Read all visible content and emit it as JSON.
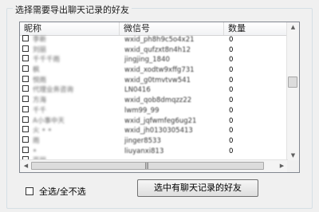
{
  "group": {
    "title": "选择需要导出聊天记录的好友"
  },
  "table": {
    "columns": [
      "昵称",
      "微信号",
      "数量"
    ],
    "rows": [
      {
        "nick": "李新",
        "wechat_id": "wxid_ph8h9c5o4x21",
        "count": "0"
      },
      {
        "nick": "刘丽",
        "wechat_id": "wxid_qufzxt8n4h12",
        "count": "0"
      },
      {
        "nick": "千千千雨",
        "wechat_id": "jingjing_1840",
        "count": "0"
      },
      {
        "nick": "枫",
        "wechat_id": "wxid_xodtw9xffg731",
        "count": "0"
      },
      {
        "nick": "悦雨",
        "wechat_id": "wxid_g0tmvtvw541",
        "count": "0"
      },
      {
        "nick": "代理业务咨询",
        "wechat_id": "LN0416",
        "count": "0"
      },
      {
        "nick": "方海",
        "wechat_id": "wxid_qob8dmqzz22",
        "count": "0"
      },
      {
        "nick": "千千",
        "wechat_id": "lwm99_99",
        "count": "0"
      },
      {
        "nick": "A小事中天",
        "wechat_id": "wxid_jqfwmfeg6ug21",
        "count": "0"
      },
      {
        "nick": "火 • •",
        "wechat_id": "wxid_jh0130305413",
        "count": "0"
      },
      {
        "nick": "雨",
        "wechat_id": "jinger8533",
        "count": "0"
      },
      {
        "nick": "•",
        "wechat_id": "liuyanxi813",
        "count": "0"
      },
      {
        "nick": "亚丽",
        "wechat_id": "",
        "count": ""
      }
    ]
  },
  "controls": {
    "select_all_label": "全选/全不选",
    "select_chatted_button": "选中有聊天记录的好友"
  },
  "icons": {
    "scroll_up": "▲",
    "scroll_down": "▼",
    "scroll_left": "◀",
    "scroll_right": "▶",
    "grip": "|||"
  }
}
